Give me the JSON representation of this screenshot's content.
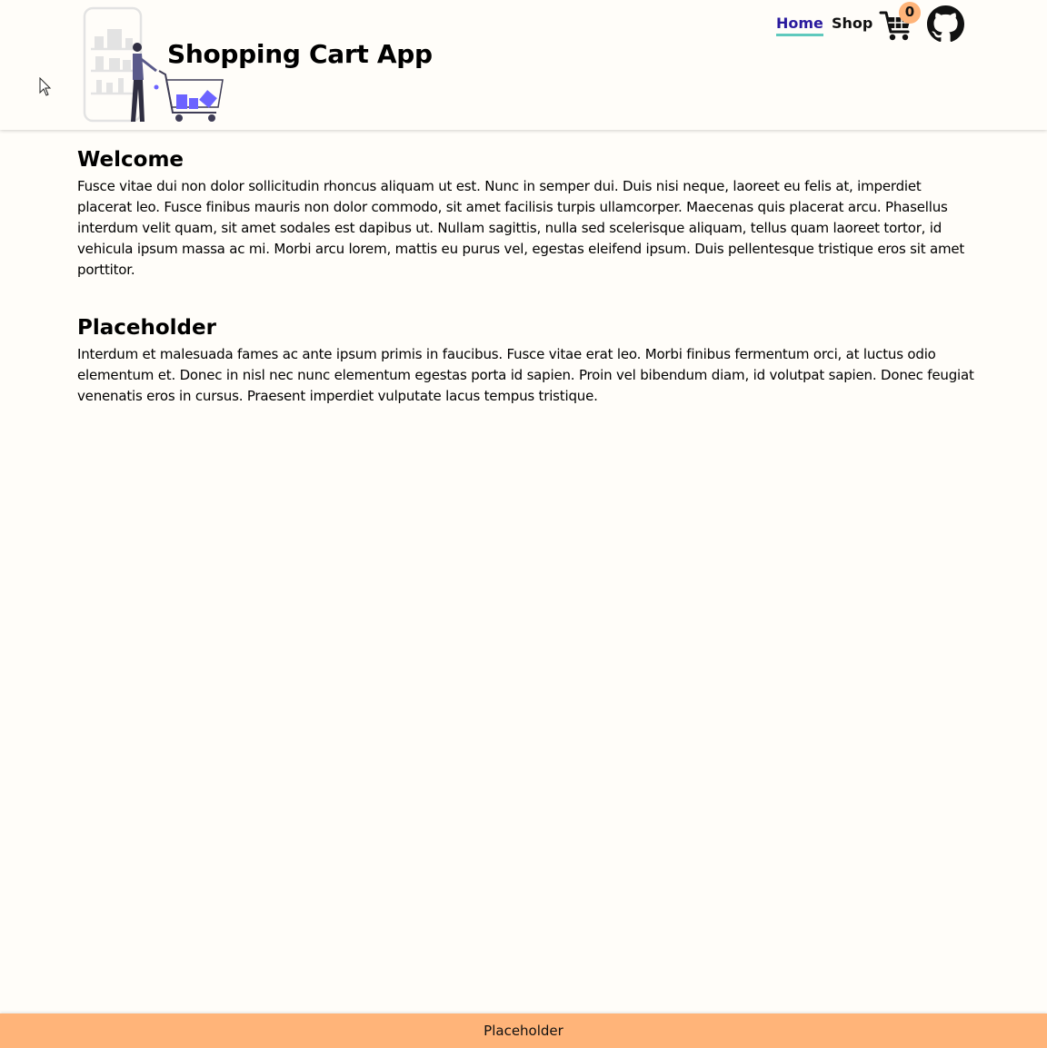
{
  "header": {
    "title": "Shopping Cart App",
    "nav": {
      "home": "Home",
      "shop": "Shop"
    },
    "cart_count": "0",
    "icons": {
      "logo": "shopping-illustration",
      "cart": "cart-icon",
      "github": "github-icon"
    }
  },
  "sections": [
    {
      "title": "Welcome",
      "body": "Fusce vitae dui non dolor sollicitudin rhoncus aliquam ut est. Nunc in semper dui. Duis nisi neque, laoreet eu felis at, imperdiet placerat leo. Fusce finibus mauris non dolor commodo, sit amet facilisis turpis ullamcorper. Maecenas quis placerat arcu. Phasellus interdum velit quam, sit amet sodales est dapibus ut. Nullam sagittis, nulla sed scelerisque aliquam, tellus quam laoreet tortor, id vehicula ipsum massa ac mi. Morbi arcu lorem, mattis eu purus vel, egestas eleifend ipsum. Duis pellentesque tristique eros sit amet porttitor."
    },
    {
      "title": "Placeholder",
      "body": "Interdum et malesuada fames ac ante ipsum primis in faucibus. Fusce vitae erat leo. Morbi finibus fermentum orci, at luctus odio elementum et. Donec in nisl nec nunc elementum egestas porta id sapien. Proin vel bibendum diam, id volutpat sapien. Donec feugiat venenatis eros in cursus. Praesent imperdiet vulputate lacus tempus tristique."
    }
  ],
  "footer": {
    "text": "Placeholder"
  },
  "colors": {
    "background": "#fffdf9",
    "accent_orange": "#ffb479",
    "nav_active": "#2a1a9e",
    "nav_underline": "#5fc9bd",
    "illustration_purple": "#6c63ff"
  }
}
